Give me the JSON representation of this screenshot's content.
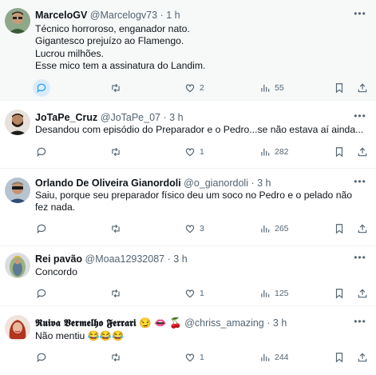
{
  "tweets": [
    {
      "display_name": "MarceloGV",
      "handle": "@Marcelogv73",
      "time": "1 h",
      "lines": [
        "Técnico horroroso, enganador nato.",
        "Gigantesco prejuízo ao Flamengo.",
        "Lucrou milhões.",
        "Esse mico tem a assinatura do Landim."
      ],
      "replies": "",
      "retweets": "",
      "likes": "2",
      "views": "55",
      "reply_highlighted": true,
      "avatar": "avatar-man-glasses"
    },
    {
      "display_name": "JoTaPe_Cruz",
      "handle": "@JoTaPe_07",
      "time": "3 h",
      "lines": [
        "Desandou com episódio do Preparador e o Pedro...se não estava aí ainda..."
      ],
      "replies": "",
      "retweets": "",
      "likes": "1",
      "views": "282",
      "reply_highlighted": false,
      "avatar": "avatar-man-beard"
    },
    {
      "display_name": "Orlando De Oliveira Gianordoli",
      "handle": "@o_gianordoli",
      "time": "3 h",
      "lines": [
        "Saiu, porque seu preparador físico deu um soco no Pedro e o pelado não",
        "fez nada."
      ],
      "replies": "",
      "retweets": "",
      "likes": "3",
      "views": "265",
      "reply_highlighted": false,
      "avatar": "avatar-man-sunglasses"
    },
    {
      "display_name": "Rei pavão",
      "handle": "@Moaa12932087",
      "time": "3 h",
      "lines": [
        "Concordo"
      ],
      "replies": "",
      "retweets": "",
      "likes": "1",
      "views": "125",
      "reply_highlighted": false,
      "avatar": "avatar-religious-figure"
    },
    {
      "display_name": "𝕽𝖚𝖎𝖛𝖆 𝖁𝖊𝖗𝖒𝖊𝖑𝖍𝖔 𝕱𝖊𝖗𝖗𝖆𝖗𝖎",
      "name_emojis": "😏 👄 🍒",
      "handle": "@chriss_amazing",
      "time": "3 h",
      "lines": [
        "Não mentiu 😂😂😂"
      ],
      "replies": "",
      "retweets": "",
      "likes": "1",
      "views": "244",
      "reply_highlighted": false,
      "avatar": "avatar-woman-red-hair"
    }
  ],
  "colors": {
    "text": "#0f1419",
    "secondary": "#536471",
    "accent": "#1d9bf0",
    "divider": "#eff3f4",
    "highlight_bg": "#f7f9f9"
  },
  "icons": [
    "reply-icon",
    "retweet-icon",
    "like-icon",
    "views-icon",
    "bookmark-icon",
    "share-icon",
    "more-icon"
  ]
}
